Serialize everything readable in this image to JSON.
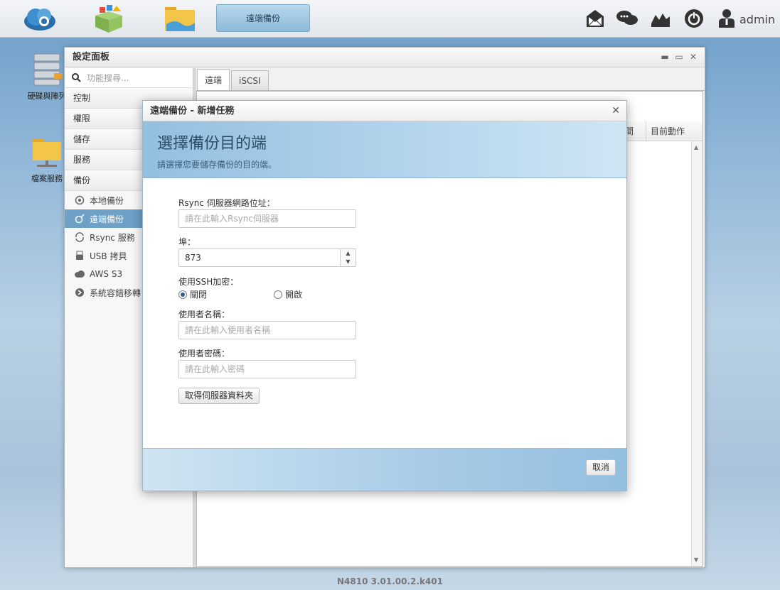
{
  "taskbar": {
    "active_task": "遠端備份",
    "user": "admin"
  },
  "desktop": {
    "icons": [
      {
        "label": "硬碟與陣列"
      },
      {
        "label": "檔案服務"
      }
    ]
  },
  "settings": {
    "title": "設定面板",
    "search_placeholder": "功能搜尋...",
    "categories": [
      "控制",
      "權限",
      "儲存",
      "服務",
      "備份"
    ],
    "subitems": [
      {
        "label": "本地備份",
        "icon": "local-backup-icon"
      },
      {
        "label": "遠端備份",
        "icon": "remote-backup-icon"
      },
      {
        "label": "Rsync 服務",
        "icon": "rsync-icon"
      },
      {
        "label": "USB 拷貝",
        "icon": "usb-icon"
      },
      {
        "label": "AWS S3",
        "icon": "cloud-icon"
      },
      {
        "label": "系統容錯移轉",
        "icon": "failover-icon"
      }
    ],
    "tabs": [
      "遠端",
      "iSCSI"
    ],
    "grid_headers": [
      "間",
      "目前動作"
    ]
  },
  "dialog": {
    "title": "遠端備份 - 新增任務",
    "heading": "選擇備份目的端",
    "subheading": "請選擇您要儲存備份的目的端。",
    "server_label": "Rsync 伺服器網路位址：",
    "server_placeholder": "請在此輸入Rsync伺服器",
    "port_label": "埠：",
    "port_value": "873",
    "ssh_label": "使用SSH加密：",
    "ssh_off": "關閉",
    "ssh_on": "開啟",
    "username_label": "使用者名稱：",
    "username_placeholder": "請在此輸入使用者名稱",
    "password_label": "使用者密碼：",
    "password_placeholder": "請在此輸入密碼",
    "fetch_button": "取得伺服器資料夾",
    "cancel_button": "取消"
  },
  "footer": {
    "version": "N4810   3.01.00.2.k401"
  }
}
